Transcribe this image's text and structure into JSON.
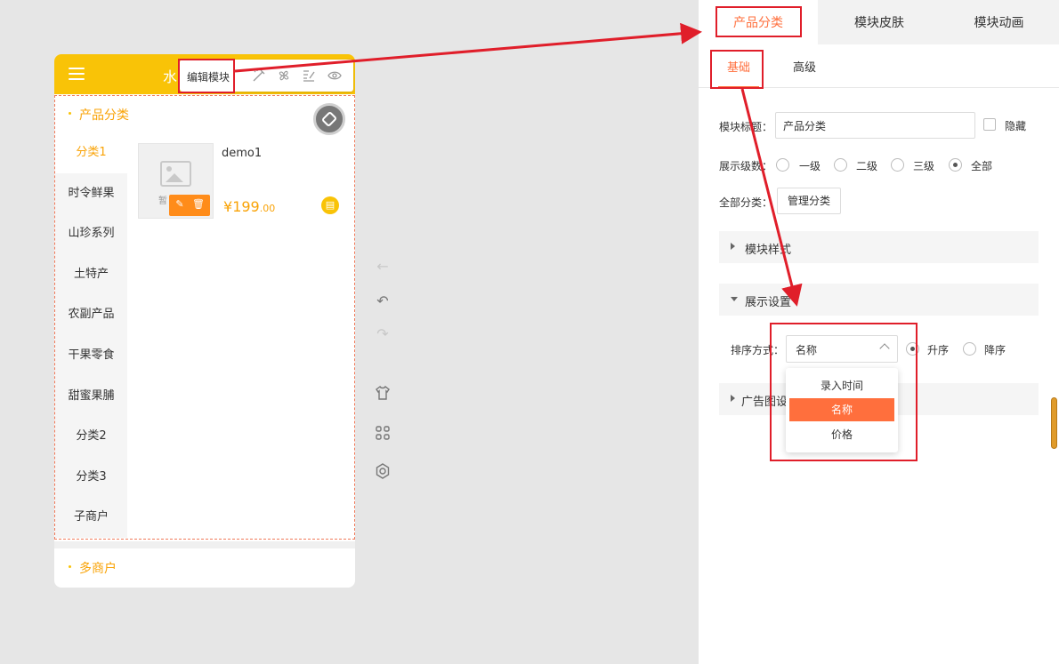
{
  "phone": {
    "title": "水",
    "toolbar": {
      "edit_label": "编辑模块",
      "icons": [
        "magic-wand-icon",
        "fan-icon",
        "edit-list-icon",
        "eye-icon"
      ]
    },
    "section1_title": "产品分类",
    "categories": [
      "分类1",
      "时令鲜果",
      "山珍系列",
      "土特产",
      "农副产品",
      "干果零食",
      "甜蜜果脯",
      "分类2",
      "分类3",
      "子商户"
    ],
    "active_category_index": 0,
    "product": {
      "name": "demo1",
      "image_placeholder_text": "暂",
      "price_symbol": "¥",
      "price_int": "199",
      "price_dec": ".00"
    },
    "section2_title": "多商户"
  },
  "middle_tools": [
    "back-arrow-icon",
    "undo-icon",
    "redo-icon",
    "tshirt-icon",
    "grid-icon",
    "settings-icon"
  ],
  "panel": {
    "top_tabs": [
      "产品分类",
      "模块皮肤",
      "模块动画"
    ],
    "sub_tabs": [
      "基础",
      "高级"
    ],
    "module_title_label": "模块标题：",
    "module_title_value": "产品分类",
    "hide_label": "隐藏",
    "level_label": "展示级数：",
    "levels": [
      "一级",
      "二级",
      "三级",
      "全部"
    ],
    "level_selected": "全部",
    "all_cat_label": "全部分类：",
    "manage_button": "管理分类",
    "style_section": "模块样式",
    "display_section": "展示设置",
    "sort_label": "排序方式：",
    "sort_value": "名称",
    "sort_orders": [
      "升序",
      "降序"
    ],
    "sort_order_selected": "升序",
    "dropdown_options": [
      "录入时间",
      "名称",
      "价格"
    ],
    "ad_section": "广告图设"
  },
  "colors": {
    "brand_yellow": "#f9c307",
    "accent_orange": "#ff6f3d",
    "annotation_red": "#e01e2a"
  }
}
